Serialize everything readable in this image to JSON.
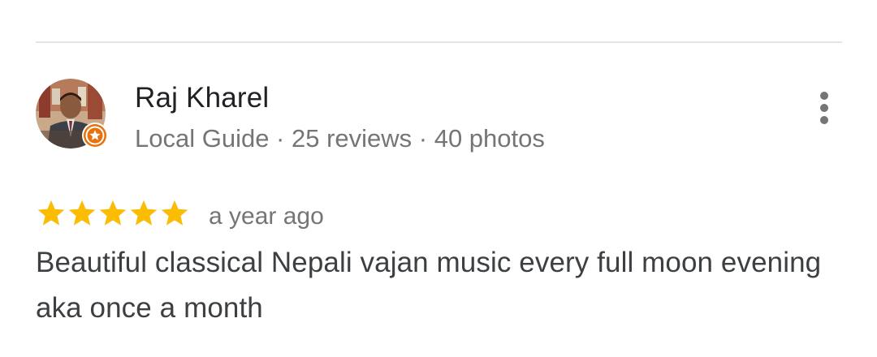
{
  "review": {
    "reviewer": {
      "name": "Raj Kharel",
      "meta": "Local Guide · 25 reviews · 40 photos",
      "badge_icon": "local-guide-star-badge-icon",
      "badge_color": "#e8710a"
    },
    "rating": {
      "value": 5,
      "max": 5,
      "star_color": "#fbbc04"
    },
    "time": "a year ago",
    "text": "Beautiful classical Nepali vajan music every full moon evening aka once a month"
  },
  "icons": {
    "more": "more-vert-icon"
  }
}
